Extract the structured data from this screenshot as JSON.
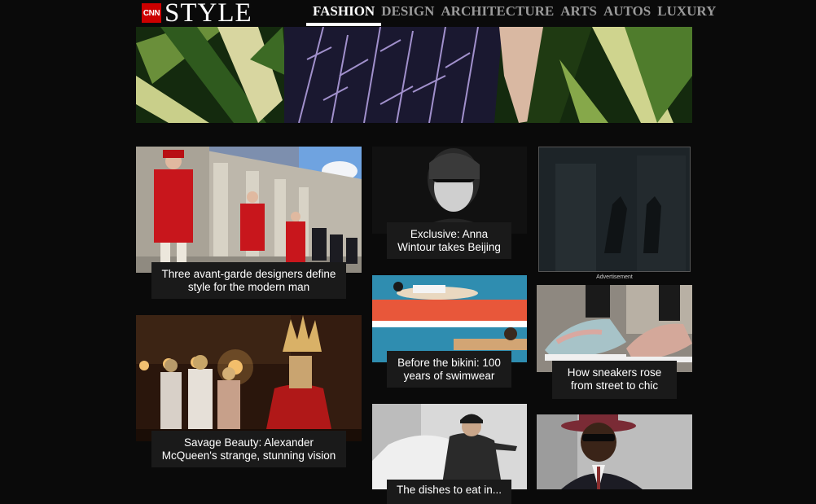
{
  "header": {
    "logo_badge": "CNN",
    "logo_word": "STYLE",
    "nav": [
      {
        "label": "FASHION",
        "active": true
      },
      {
        "label": "DESIGN",
        "active": false
      },
      {
        "label": "ARCHITECTURE",
        "active": false
      },
      {
        "label": "ARTS",
        "active": false
      },
      {
        "label": "AUTOS",
        "active": false
      },
      {
        "label": "LUXURY",
        "active": false
      }
    ]
  },
  "stories": [
    {
      "caption": "Three avant-garde designers define style for the modern man"
    },
    {
      "caption": "Exclusive: Anna Wintour takes Beijing"
    },
    {
      "caption": "Before the bikini: 100 years of swimwear"
    },
    {
      "caption": "How sneakers rose from street to chic"
    },
    {
      "caption": "Savage Beauty: Alexander McQueen's strange, stunning vision"
    },
    {
      "caption": "The dishes to eat in..."
    }
  ],
  "ad": {
    "label": "Advertisement"
  },
  "colors": {
    "background": "#0a0a0a",
    "caption_bg": "#1a1a1a",
    "cnn_red": "#cc0000",
    "nav_inactive": "#9a9a9a"
  }
}
